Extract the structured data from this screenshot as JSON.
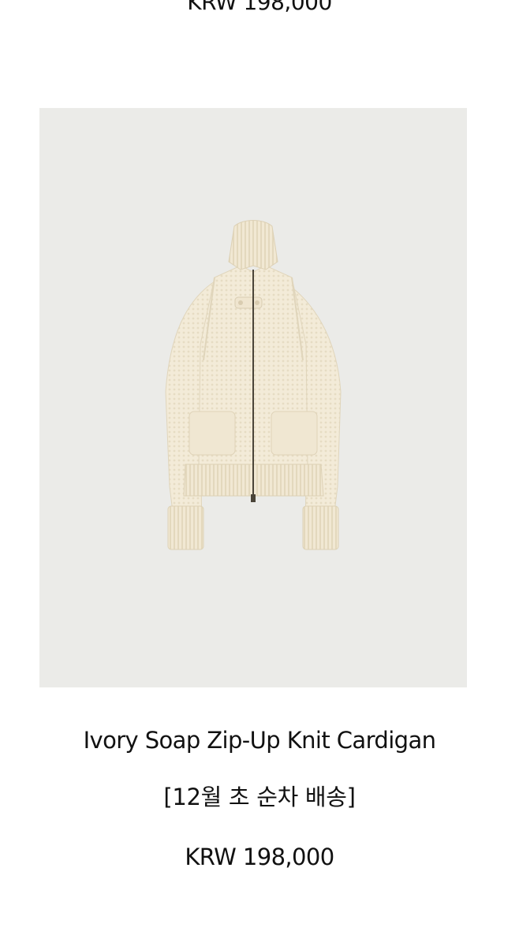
{
  "previous_item": {
    "price": "KRW 198,000"
  },
  "product": {
    "name": "Ivory Soap Zip-Up Knit Cardigan",
    "note": "[12월 초 순차 배송]",
    "price": "KRW 198,000",
    "image_subject": "ivory knit zip-up cardigan",
    "colors": {
      "background": "#ebebe8",
      "garment": "#f2ead6"
    }
  }
}
